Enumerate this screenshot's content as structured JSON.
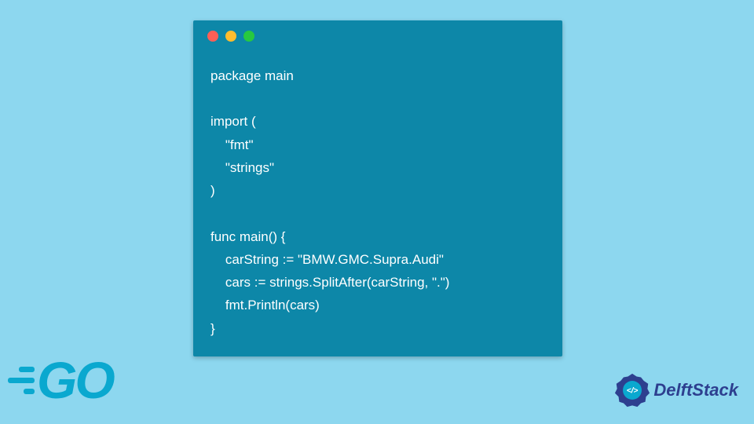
{
  "code_window": {
    "traffic_lights": [
      "red",
      "yellow",
      "green"
    ],
    "code_text": "package main\n\nimport (\n    \"fmt\"\n    \"strings\"\n)\n\nfunc main() {\n    carString := \"BMW.GMC.Supra.Audi\"\n    cars := strings.SplitAfter(carString, \".\")\n    fmt.Println(cars)\n}"
  },
  "logos": {
    "go_text": "GO",
    "delftstack_text": "DelftStack"
  },
  "colors": {
    "page_bg": "#8dd7ef",
    "window_bg": "#0d87a8",
    "go_blue": "#0aa8cf",
    "delft_blue": "#2d3f8f"
  }
}
